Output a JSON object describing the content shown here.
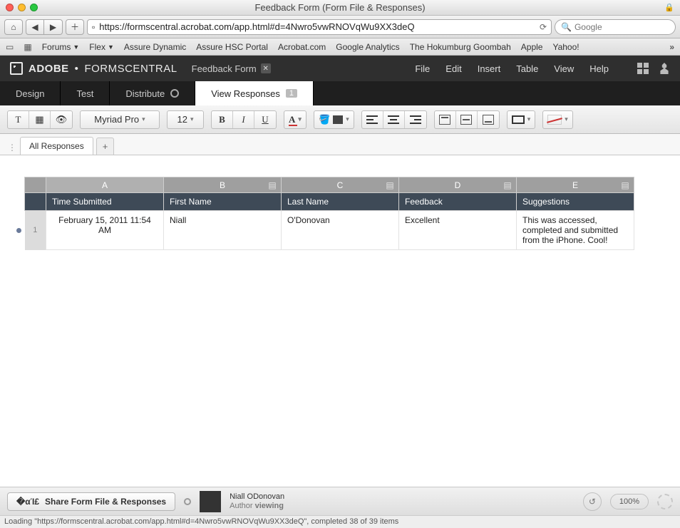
{
  "window": {
    "title": "Feedback Form (Form File & Responses)"
  },
  "browser": {
    "url": "https://formscentral.acrobat.com/app.html#d=4Nwro5vwRNOVqWu9XX3deQ",
    "search_placeholder": "Google",
    "bookmarks": [
      "Forums",
      "Flex",
      "Assure Dynamic",
      "Assure HSC Portal",
      "Acrobat.com",
      "Google Analytics",
      "The Hokumburg Goombah",
      "Apple",
      "Yahoo!"
    ]
  },
  "app": {
    "brand1": "ADOBE",
    "brand2": "FORMSCENTRAL",
    "form_title": "Feedback Form",
    "menus": [
      "File",
      "Edit",
      "Insert",
      "Table",
      "View",
      "Help"
    ]
  },
  "subtabs": {
    "items": [
      "Design",
      "Test",
      "Distribute",
      "View Responses"
    ],
    "active_index": 3,
    "response_count": "1"
  },
  "toolbar": {
    "font": "Myriad Pro",
    "size": "12"
  },
  "sheet": {
    "tab_label": "All Responses",
    "column_letters": [
      "A",
      "B",
      "C",
      "D",
      "E"
    ],
    "headers": [
      "Time Submitted",
      "First Name",
      "Last Name",
      "Feedback",
      "Suggestions"
    ],
    "rows": [
      {
        "num": "1",
        "cells": [
          "February 15, 2011 11:54 AM",
          "Niall",
          "O'Donovan",
          "Excellent",
          "This was accessed, completed and submitted from the iPhone. Cool!"
        ]
      }
    ]
  },
  "footer": {
    "share_label": "Share Form File & Responses",
    "user_name": "Niall ODonovan",
    "user_role": "Author",
    "user_status": "viewing",
    "zoom": "100%"
  },
  "status": "Loading \"https://formscentral.acrobat.com/app.html#d=4Nwro5vwRNOVqWu9XX3deQ\", completed 38 of 39 items"
}
